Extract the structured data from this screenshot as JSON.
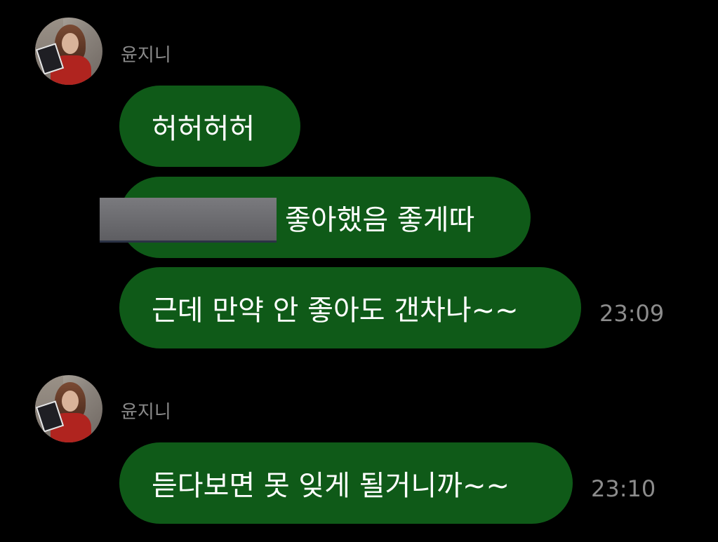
{
  "messages": [
    {
      "sender": "윤지니",
      "bubbles": [
        "허허허허",
        "좋아했음 좋게따",
        "근데 만약 안 좋아도 갠차나~~"
      ],
      "time": "23:09"
    },
    {
      "sender": "윤지니",
      "bubbles": [
        "듣다보면 못 잊게 될거니까~~"
      ],
      "time": "23:10"
    }
  ],
  "colors": {
    "background": "#000000",
    "bubble": "#0f5a18",
    "sender_text": "#8a8a8a",
    "time_text": "#8c8c8c"
  }
}
